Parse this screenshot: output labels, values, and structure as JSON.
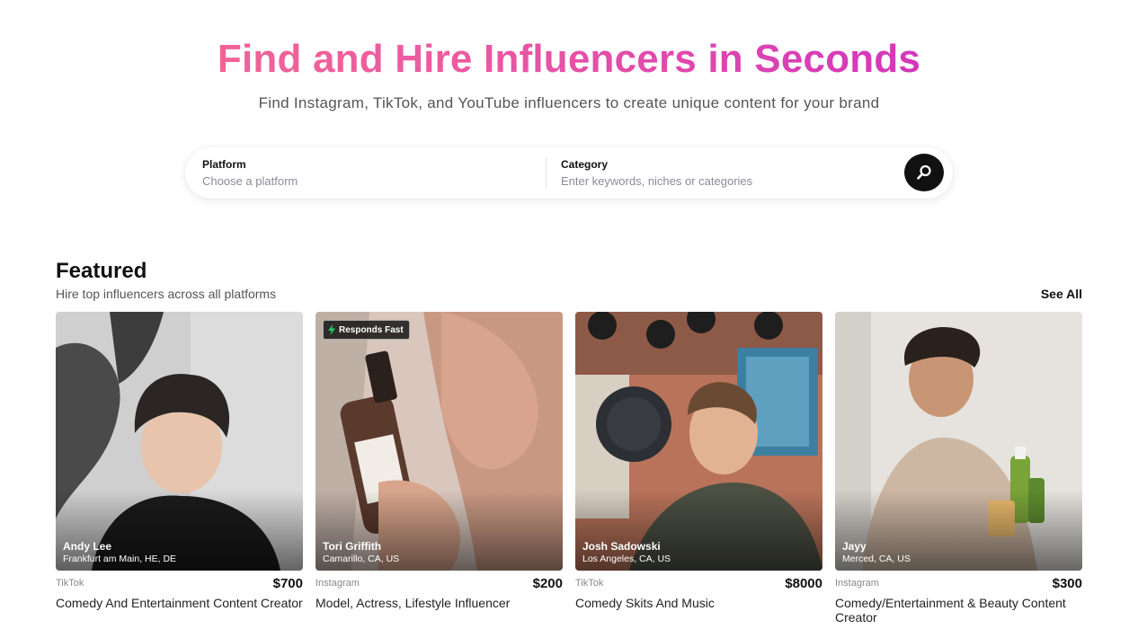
{
  "hero": {
    "title": "Find and Hire Influencers in Seconds",
    "subtitle": "Find Instagram, TikTok, and YouTube influencers to create unique content for your brand"
  },
  "search": {
    "platform_label": "Platform",
    "platform_placeholder": "Choose a platform",
    "category_label": "Category",
    "category_placeholder": "Enter keywords, niches or categories",
    "button_icon": "search-icon"
  },
  "featured": {
    "title": "Featured",
    "subtitle": "Hire top influencers across all platforms",
    "see_all": "See All",
    "cards": [
      {
        "name": "Andy Lee",
        "location": "Frankfurt am Main, HE, DE",
        "platform": "TikTok",
        "price": "$700",
        "description": "Comedy And Entertainment Content Creator",
        "badge": ""
      },
      {
        "name": "Tori Griffith",
        "location": "Camarillo, CA, US",
        "platform": "Instagram",
        "price": "$200",
        "description": "Model, Actress, Lifestyle Influencer",
        "badge": "Responds Fast"
      },
      {
        "name": "Josh Sadowski",
        "location": "Los Angeles, CA, US",
        "platform": "TikTok",
        "price": "$8000",
        "description": "Comedy Skits And Music",
        "badge": ""
      },
      {
        "name": "Jayy",
        "location": "Merced, CA, US",
        "platform": "Instagram",
        "price": "$300",
        "description": "Comedy/Entertainment & Beauty Content Creator",
        "badge": ""
      }
    ]
  },
  "colors": {
    "title_gradient_start": "#f26d8f",
    "title_gradient_end": "#c02fc4",
    "badge_bolt": "#22c55e"
  }
}
